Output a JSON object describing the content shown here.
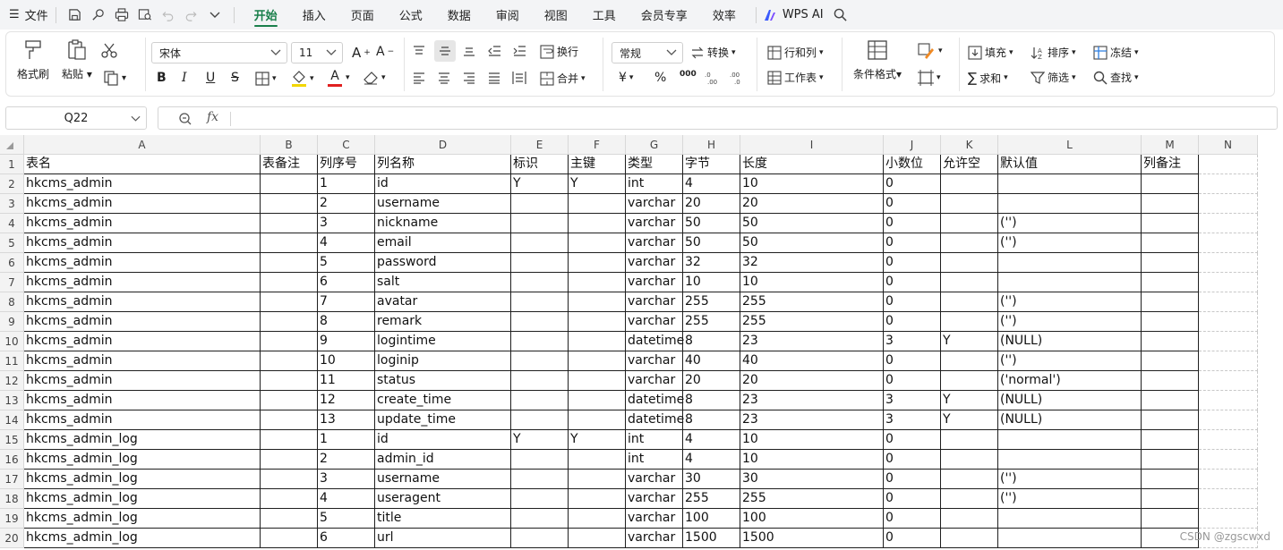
{
  "menubar": {
    "file_label": "文件",
    "tabs": [
      {
        "label": "开始",
        "active": true
      },
      {
        "label": "插入"
      },
      {
        "label": "页面"
      },
      {
        "label": "公式"
      },
      {
        "label": "数据"
      },
      {
        "label": "审阅"
      },
      {
        "label": "视图"
      },
      {
        "label": "工具"
      },
      {
        "label": "会员专享"
      },
      {
        "label": "效率"
      }
    ],
    "wps_ai_label": "WPS AI",
    "accent_color": "#1a7f4b"
  },
  "ribbon": {
    "format_painter": "格式刷",
    "paste": "粘贴",
    "font_name": "宋体",
    "font_size": "11",
    "wrap": "换行",
    "merge": "合并",
    "number_format": "常规",
    "convert": "转换",
    "rows_cols": "行和列",
    "worksheet": "工作表",
    "cond_format": "条件格式",
    "fill": "填充",
    "sort": "排序",
    "freeze": "冻结",
    "sum": "求和",
    "filter": "筛选",
    "find": "查找",
    "percent": "%",
    "thousands": "000",
    "yen": "¥",
    "bold": "B",
    "italic": "I",
    "underline": "U",
    "strike": "S",
    "font_color": "A",
    "fill_color_value": "#f2d600",
    "font_color_value": "#e02020"
  },
  "formula_bar": {
    "name_box": "Q22",
    "fx": "fx",
    "formula": ""
  },
  "columns": [
    "A",
    "B",
    "C",
    "D",
    "E",
    "F",
    "G",
    "H",
    "I",
    "J",
    "K",
    "L",
    "M",
    "N"
  ],
  "rows": [
    [
      "表名",
      "表备注",
      "列序号",
      "列名称",
      "标识",
      "主键",
      "类型",
      "字节",
      "长度",
      "小数位",
      "允许空",
      "默认值",
      "列备注"
    ],
    [
      "hkcms_admin",
      "",
      "1",
      "id",
      "Y",
      "Y",
      "int",
      "4",
      "10",
      "0",
      "",
      "",
      ""
    ],
    [
      "hkcms_admin",
      "",
      "2",
      "username",
      "",
      "",
      "varchar",
      "20",
      "20",
      "0",
      "",
      "",
      ""
    ],
    [
      "hkcms_admin",
      "",
      "3",
      "nickname",
      "",
      "",
      "varchar",
      "50",
      "50",
      "0",
      "",
      "('')",
      ""
    ],
    [
      "hkcms_admin",
      "",
      "4",
      "email",
      "",
      "",
      "varchar",
      "50",
      "50",
      "0",
      "",
      "('')",
      ""
    ],
    [
      "hkcms_admin",
      "",
      "5",
      "password",
      "",
      "",
      "varchar",
      "32",
      "32",
      "0",
      "",
      "",
      ""
    ],
    [
      "hkcms_admin",
      "",
      "6",
      "salt",
      "",
      "",
      "varchar",
      "10",
      "10",
      "0",
      "",
      "",
      ""
    ],
    [
      "hkcms_admin",
      "",
      "7",
      "avatar",
      "",
      "",
      "varchar",
      "255",
      "255",
      "0",
      "",
      "('')",
      ""
    ],
    [
      "hkcms_admin",
      "",
      "8",
      "remark",
      "",
      "",
      "varchar",
      "255",
      "255",
      "0",
      "",
      "('')",
      ""
    ],
    [
      "hkcms_admin",
      "",
      "9",
      "logintime",
      "",
      "",
      "datetime",
      "8",
      "23",
      "3",
      "Y",
      "(NULL)",
      ""
    ],
    [
      "hkcms_admin",
      "",
      "10",
      "loginip",
      "",
      "",
      "varchar",
      "40",
      "40",
      "0",
      "",
      "('')",
      ""
    ],
    [
      "hkcms_admin",
      "",
      "11",
      "status",
      "",
      "",
      "varchar",
      "20",
      "20",
      "0",
      "",
      "('normal')",
      ""
    ],
    [
      "hkcms_admin",
      "",
      "12",
      "create_time",
      "",
      "",
      "datetime",
      "8",
      "23",
      "3",
      "Y",
      "(NULL)",
      ""
    ],
    [
      "hkcms_admin",
      "",
      "13",
      "update_time",
      "",
      "",
      "datetime",
      "8",
      "23",
      "3",
      "Y",
      "(NULL)",
      ""
    ],
    [
      "hkcms_admin_log",
      "",
      "1",
      "id",
      "Y",
      "Y",
      "int",
      "4",
      "10",
      "0",
      "",
      "",
      ""
    ],
    [
      "hkcms_admin_log",
      "",
      "2",
      "admin_id",
      "",
      "",
      "int",
      "4",
      "10",
      "0",
      "",
      "",
      ""
    ],
    [
      "hkcms_admin_log",
      "",
      "3",
      "username",
      "",
      "",
      "varchar",
      "30",
      "30",
      "0",
      "",
      "('')",
      ""
    ],
    [
      "hkcms_admin_log",
      "",
      "4",
      "useragent",
      "",
      "",
      "varchar",
      "255",
      "255",
      "0",
      "",
      "('')",
      ""
    ],
    [
      "hkcms_admin_log",
      "",
      "5",
      "title",
      "",
      "",
      "varchar",
      "100",
      "100",
      "0",
      "",
      "",
      ""
    ],
    [
      "hkcms_admin_log",
      "",
      "6",
      "url",
      "",
      "",
      "varchar",
      "1500",
      "1500",
      "0",
      "",
      "",
      ""
    ]
  ],
  "row_numbers": [
    "1",
    "2",
    "3",
    "4",
    "5",
    "6",
    "7",
    "8",
    "9",
    "10",
    "11",
    "12",
    "13",
    "14",
    "15",
    "16",
    "17",
    "18",
    "19",
    "20"
  ],
  "watermark": "CSDN @zgscwxd"
}
